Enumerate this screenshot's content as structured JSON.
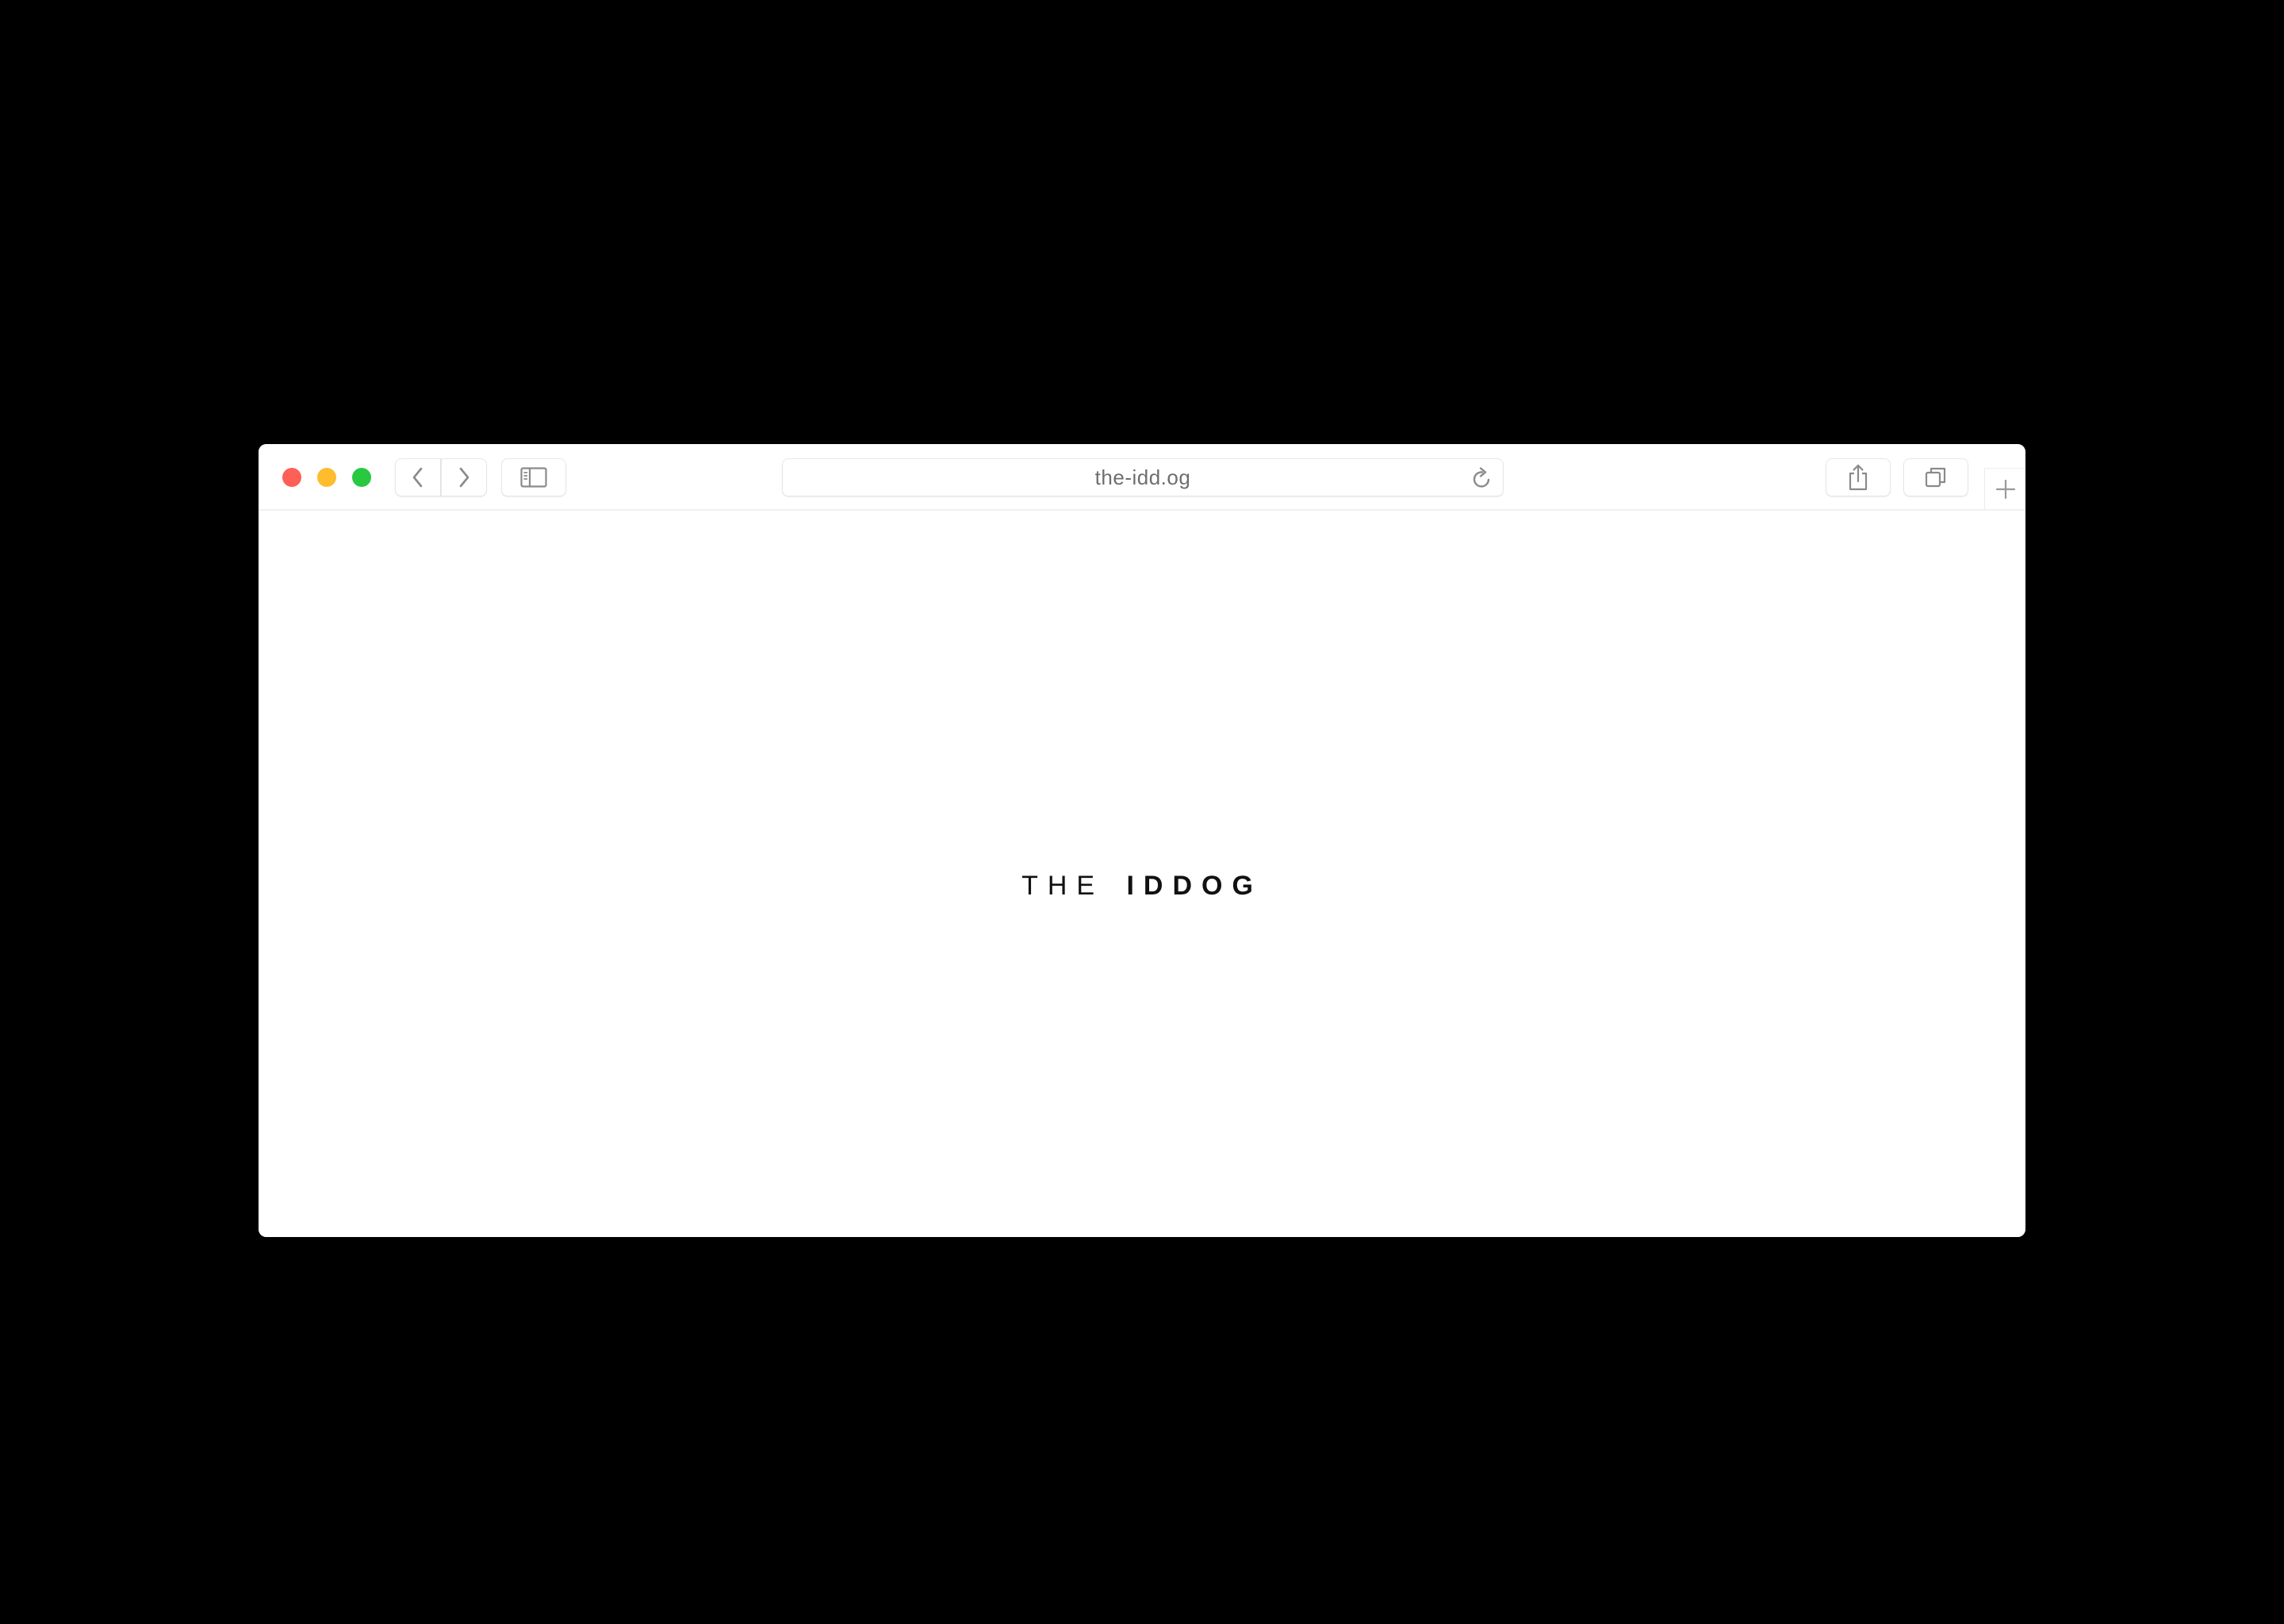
{
  "browser": {
    "address": "the-idd.og",
    "colors": {
      "close": "#fe5f57",
      "minimize": "#febc2e",
      "zoom": "#28c840",
      "icon": "#8a8a8a"
    },
    "icons": {
      "back": "chevron-left-icon",
      "forward": "chevron-right-icon",
      "sidebar": "sidebar-icon",
      "reload": "reload-icon",
      "share": "share-icon",
      "tabs": "tabs-overview-icon",
      "new_tab": "plus-icon"
    }
  },
  "page": {
    "logo_light": "THE",
    "logo_bold": "IDDOG"
  }
}
